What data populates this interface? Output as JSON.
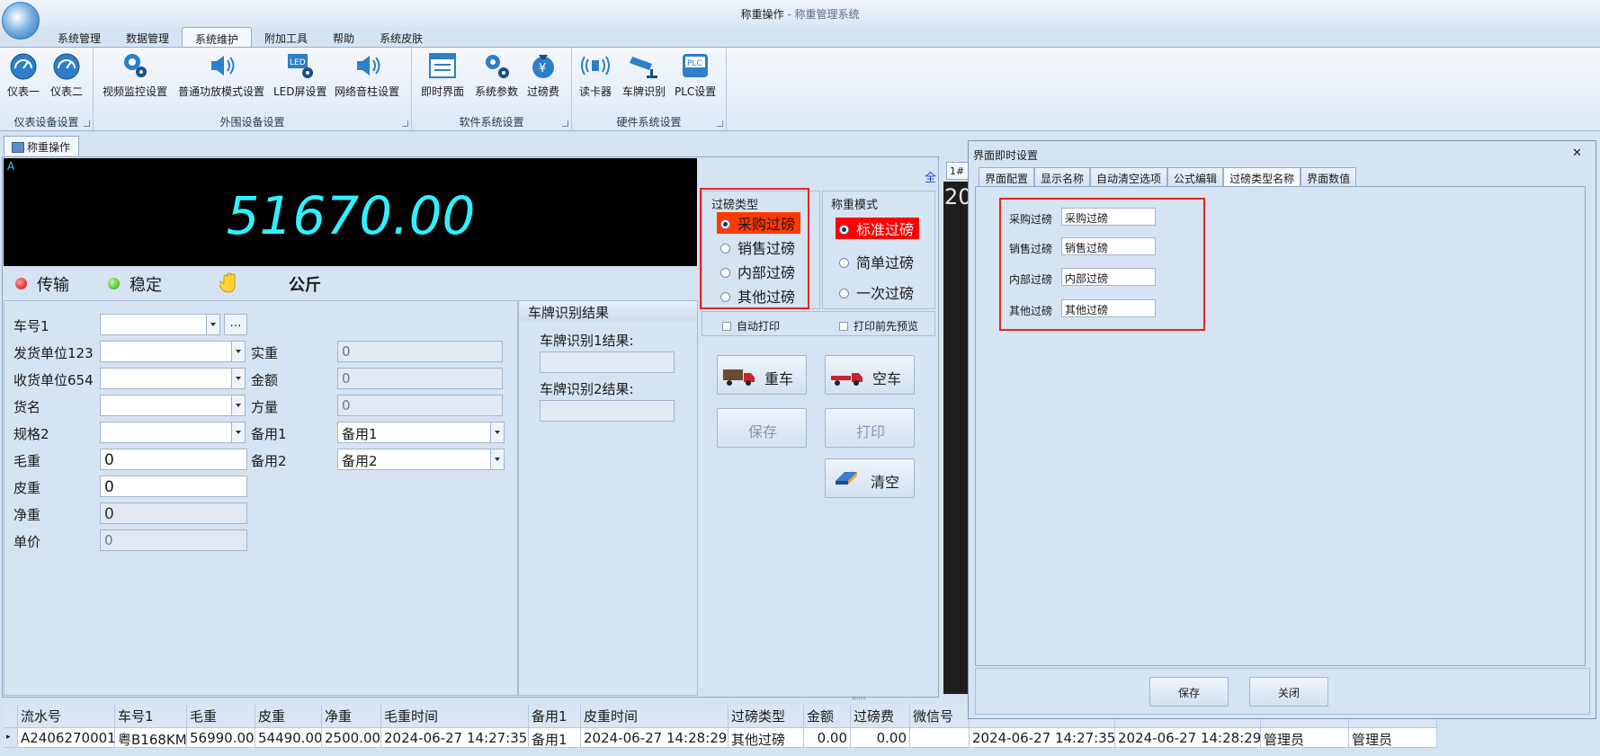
{
  "window": {
    "title": "称重操作",
    "title_sep": " - ",
    "app_name": "称重管理系统"
  },
  "menu": [
    "系统管理",
    "数据管理",
    "系统维护",
    "附加工具",
    "帮助",
    "系统皮肤"
  ],
  "ribbon": {
    "groups": [
      {
        "label": "仪表设备设置",
        "buttons": [
          {
            "label": "仪表一",
            "icon": "gauge-icon"
          },
          {
            "label": "仪表二",
            "icon": "gauge-icon"
          }
        ]
      },
      {
        "label": "外围设备设置",
        "buttons": [
          {
            "label": "视频监控设置",
            "icon": "camera-gear-icon"
          },
          {
            "label": "普通功放模式设置",
            "icon": "speaker-icon"
          },
          {
            "label": "LED屏设置",
            "icon": "led-icon"
          },
          {
            "label": "网络音柱设置",
            "icon": "speaker-icon"
          }
        ]
      },
      {
        "label": "软件系统设置",
        "buttons": [
          {
            "label": "即时界面",
            "icon": "window-icon"
          },
          {
            "label": "系统参数",
            "icon": "gears-icon"
          },
          {
            "label": "过磅费",
            "icon": "money-bag-icon"
          }
        ]
      },
      {
        "label": "硬件系统设置",
        "buttons": [
          {
            "label": "读卡器",
            "icon": "card-reader-icon"
          },
          {
            "label": "车牌识别",
            "icon": "cctv-icon"
          },
          {
            "label": "PLC设置",
            "icon": "plc-icon"
          }
        ]
      }
    ]
  },
  "doc_tab": "称重操作",
  "display": {
    "corner": "A",
    "weight": "51670.00"
  },
  "status": {
    "transmit": "传输",
    "stable": "稳定",
    "unit": "公斤"
  },
  "form": {
    "left": [
      {
        "label": "车号1",
        "value": "",
        "kind": "combo-dots"
      },
      {
        "label": "发货单位123",
        "value": "",
        "kind": "combo"
      },
      {
        "label": "收货单位654",
        "value": "",
        "kind": "combo"
      },
      {
        "label": "货名",
        "value": "",
        "kind": "combo"
      },
      {
        "label": "规格2",
        "value": "",
        "kind": "combo"
      },
      {
        "label": "毛重",
        "value": "0",
        "kind": "input"
      },
      {
        "label": "皮重",
        "value": "0",
        "kind": "input"
      },
      {
        "label": "净重",
        "value": "0",
        "kind": "readonly"
      },
      {
        "label": "单价",
        "value": "0",
        "kind": "readonly"
      }
    ],
    "right": [
      {
        "label": "实重",
        "value": "0"
      },
      {
        "label": "金额",
        "value": "0"
      },
      {
        "label": "方量",
        "value": "0"
      },
      {
        "label": "备用1",
        "value": "备用1"
      },
      {
        "label": "备用2",
        "value": "备用2"
      }
    ]
  },
  "plate": {
    "header": "车牌识别结果",
    "label1": "车牌识别1结果:",
    "label2": "车牌识别2结果:",
    "value1": "",
    "value2": ""
  },
  "control": {
    "link": "全",
    "weigh_type": {
      "title": "过磅类型",
      "options": [
        "采购过磅",
        "销售过磅",
        "内部过磅",
        "其他过磅"
      ]
    },
    "weigh_mode": {
      "title": "称重模式",
      "options": [
        "标准过磅",
        "简单过磅",
        "一次过磅"
      ]
    },
    "auto_print": "自动打印",
    "preview": "打印前先预览",
    "buttons": {
      "heavy": "重车",
      "empty": "空车",
      "save": "保存",
      "print": "打印",
      "clear": "清空"
    }
  },
  "grid": {
    "headers": [
      "流水号",
      "车号1",
      "毛重",
      "皮重",
      "净重",
      "毛重时间",
      "备用1",
      "皮重时间",
      "过磅类型",
      "金额",
      "过磅费",
      "微信号",
      "",
      "",
      "",
      ""
    ],
    "row": [
      "A2406270001",
      "粤B168KM",
      "56990.00",
      "54490.00",
      "2500.00",
      "2024-06-27 14:27:35",
      "备用1",
      "2024-06-27 14:28:29",
      "其他过磅",
      "0.00",
      "0.00",
      "",
      "2024-06-27 14:27:35",
      "2024-06-27 14:28:29",
      "管理员",
      "管理员"
    ]
  },
  "video": {
    "tab": "1#",
    "text": "20"
  },
  "dialog": {
    "title": "界面即时设置",
    "close": "✕",
    "tabs": [
      "界面配置",
      "显示名称",
      "自动清空选项",
      "公式编辑",
      "过磅类型名称",
      "界面数值"
    ],
    "fields": [
      {
        "label": "采购过磅",
        "value": "采购过磅"
      },
      {
        "label": "销售过磅",
        "value": "销售过磅"
      },
      {
        "label": "内部过磅",
        "value": "内部过磅"
      },
      {
        "label": "其他过磅",
        "value": "其他过磅"
      }
    ],
    "save": "保存",
    "close_btn": "关闭"
  },
  "colors": {
    "accent_red": "#e52424",
    "display_text": "#30f0ff",
    "highlight": "#ff3a00"
  }
}
